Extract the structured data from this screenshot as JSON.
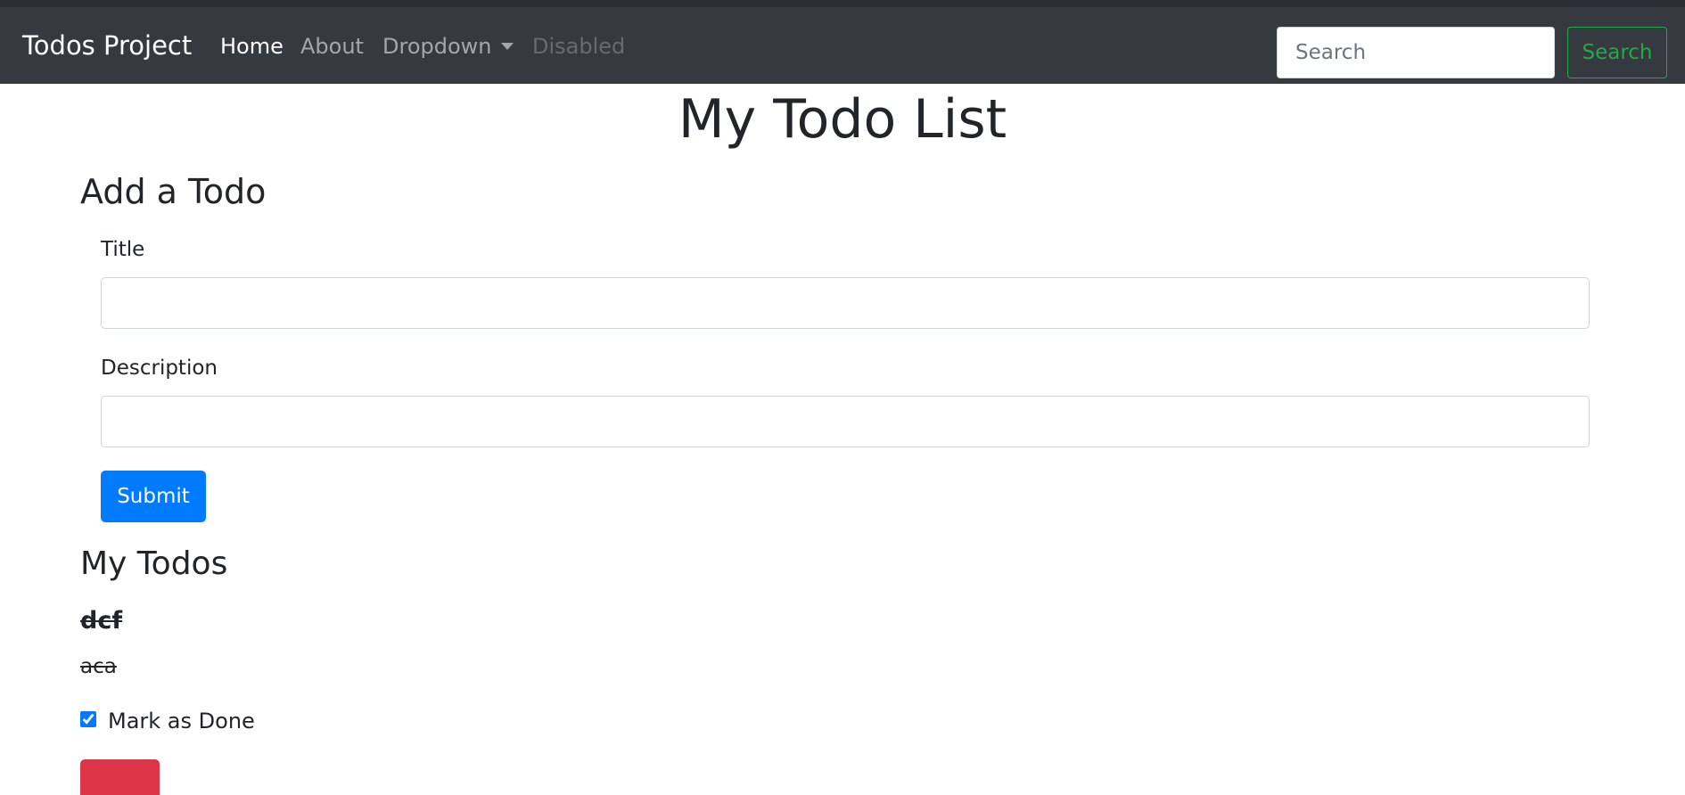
{
  "navbar": {
    "brand": "Todos Project",
    "links": [
      {
        "label": "Home",
        "state": "active"
      },
      {
        "label": "About",
        "state": "normal"
      },
      {
        "label": "Dropdown",
        "state": "normal"
      },
      {
        "label": "Disabled",
        "state": "disabled"
      }
    ],
    "search_placeholder": "Search",
    "search_button": "Search"
  },
  "page": {
    "title": "My Todo List"
  },
  "add_form": {
    "heading": "Add a Todo",
    "title_label": "Title",
    "title_value": "",
    "description_label": "Description",
    "description_value": "",
    "submit_label": "Submit"
  },
  "todos": {
    "heading": "My Todos",
    "items": [
      {
        "title": "dcf",
        "description": "aca",
        "done": true,
        "done_label": "Mark as Done"
      }
    ]
  },
  "colors": {
    "navbar_bg": "#343a40",
    "primary": "#007bff",
    "success": "#28a745",
    "danger": "#dc3545"
  },
  "icons": {
    "dropdown": "caret-down-icon"
  }
}
